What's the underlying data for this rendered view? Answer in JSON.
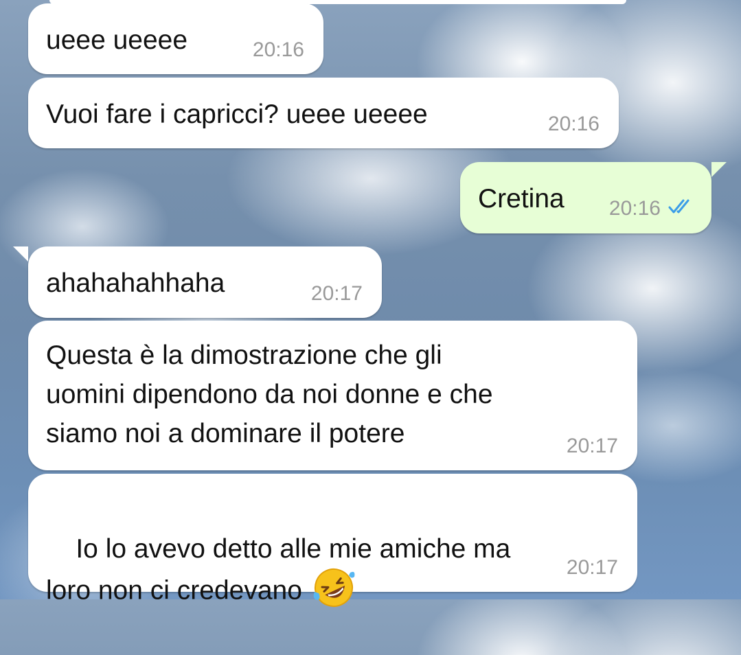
{
  "messages": [
    {
      "direction": "in",
      "text": "ueee ueeee",
      "time": "20:16"
    },
    {
      "direction": "in",
      "text": "Vuoi fare i capricci? ueee ueeee",
      "time": "20:16"
    },
    {
      "direction": "out",
      "text": "Cretina",
      "time": "20:16",
      "status": "read-double-check"
    },
    {
      "direction": "in",
      "text": "ahahahahhaha",
      "time": "20:17"
    },
    {
      "direction": "in",
      "text": "Questa è la dimostrazione che gli\nuomini dipendono da noi donne e che\nsiamo noi a dominare il potere",
      "time": "20:17"
    },
    {
      "direction": "in",
      "text": "Io lo avevo detto alle mie amiche ma\nloro non ci credevano",
      "time": "20:17",
      "emoji": "rolling-on-the-floor-laughing-emoji"
    }
  ],
  "colors": {
    "incoming_bubble": "#ffffff",
    "outgoing_bubble": "#e7fed6",
    "timestamp": "#999999",
    "read_ticks": "#3b9de8"
  }
}
